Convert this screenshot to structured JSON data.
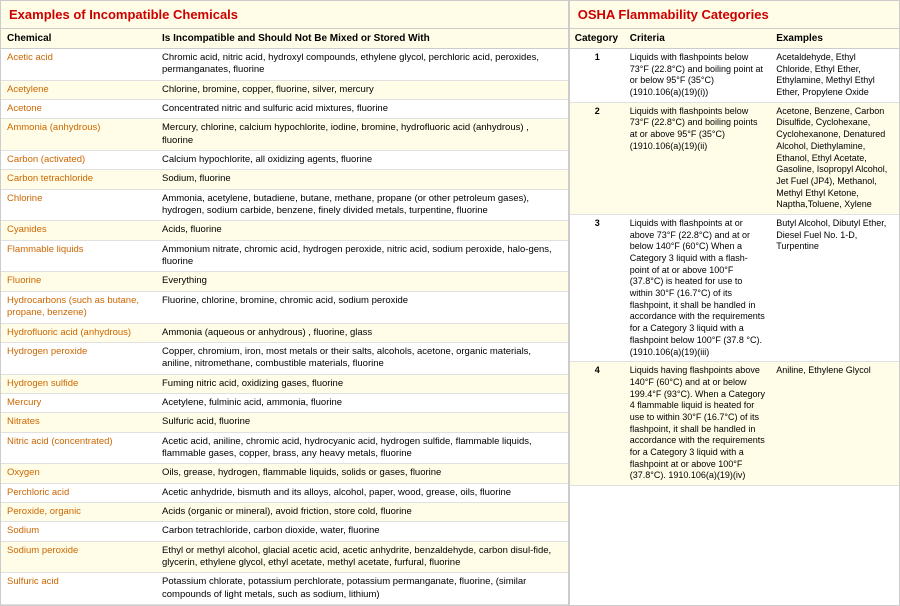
{
  "left": {
    "title": "Examples of Incompatible Chemicals",
    "col1": "Chemical",
    "col2": "Is Incompatible and Should Not Be Mixed or Stored With",
    "rows": [
      {
        "chemical": "Acetic acid",
        "incompatible": "Chromic acid, nitric acid, hydroxyl compounds, ethylene glycol, perchloric acid, peroxides, permanganates, fluorine"
      },
      {
        "chemical": "Acetylene",
        "incompatible": "Chlorine, bromine, copper, fluorine, silver, mercury"
      },
      {
        "chemical": "Acetone",
        "incompatible": "Concentrated nitric and sulfuric acid mixtures, fluorine"
      },
      {
        "chemical": "Ammonia (anhydrous)",
        "incompatible": "Mercury, chlorine, calcium hypochlorite, iodine, bromine, hydrofluoric acid (anhydrous) , fluorine"
      },
      {
        "chemical": "Carbon (activated)",
        "incompatible": "Calcium hypochlorite, all oxidizing agents, fluorine"
      },
      {
        "chemical": "Carbon tetrachloride",
        "incompatible": "Sodium, fluorine"
      },
      {
        "chemical": "Chlorine",
        "incompatible": "Ammonia, acetylene, butadiene, butane, methane, propane (or other petroleum gases), hydrogen, sodium carbide, benzene, finely divided metals, turpentine, fluorine"
      },
      {
        "chemical": "Cyanides",
        "incompatible": "Acids, fluorine"
      },
      {
        "chemical": "Flammable liquids",
        "incompatible": "Ammonium nitrate, chromic acid, hydrogen peroxide, nitric acid, sodium peroxide, halo-gens, fluorine"
      },
      {
        "chemical": "Fluorine",
        "incompatible": "Everything"
      },
      {
        "chemical": "Hydrocarbons (such as butane, propane, benzene)",
        "incompatible": "Fluorine, chlorine, bromine, chromic acid, sodium peroxide"
      },
      {
        "chemical": "Hydrofluoric acid (anhydrous)",
        "incompatible": "Ammonia (aqueous or anhydrous) , fluorine, glass"
      },
      {
        "chemical": "Hydrogen peroxide",
        "incompatible": "Copper, chromium, iron, most metals or their salts, alcohols, acetone, organic materials, aniline, nitromethane, combustible materials, fluorine"
      },
      {
        "chemical": "Hydrogen sulfide",
        "incompatible": "Fuming nitric acid, oxidizing gases, fluorine"
      },
      {
        "chemical": "Mercury",
        "incompatible": "Acetylene, fulminic acid, ammonia, fluorine"
      },
      {
        "chemical": "Nitrates",
        "incompatible": "Sulfuric acid, fluorine"
      },
      {
        "chemical": "Nitric acid (concentrated)",
        "incompatible": "Acetic acid, aniline, chromic acid, hydrocyanic acid, hydrogen sulfide, flammable liquids, flammable gases, copper, brass, any heavy metals, fluorine"
      },
      {
        "chemical": "Oxygen",
        "incompatible": "Oils, grease, hydrogen, flammable liquids, solids or gases, fluorine"
      },
      {
        "chemical": "Perchloric acid",
        "incompatible": "Acetic anhydride, bismuth and its alloys, alcohol, paper, wood, grease, oils, fluorine"
      },
      {
        "chemical": "Peroxide, organic",
        "incompatible": "Acids (organic or mineral), avoid friction, store cold, fluorine"
      },
      {
        "chemical": "Sodium",
        "incompatible": "Carbon tetrachloride, carbon dioxide, water, fluorine"
      },
      {
        "chemical": "Sodium peroxide",
        "incompatible": "Ethyl or methyl alcohol, glacial acetic acid, acetic anhydrite, benzaldehyde, carbon disul-fide, glycerin, ethylene glycol, ethyl acetate, methyl acetate, furfural, fluorine"
      },
      {
        "chemical": "Sulfuric acid",
        "incompatible": "Potassium chlorate, potassium perchlorate, potassium permanganate, fluorine, (similar compounds of light metals, such as sodium, lithium)"
      }
    ]
  },
  "right": {
    "title": "OSHA Flammability Categories",
    "col1": "Category",
    "col2": "Criteria",
    "col3": "Examples",
    "rows": [
      {
        "category": "1",
        "criteria": "Liquids with flashpoints below 73°F (22.8°C) and boiling point at or below 95°F (35°C) (1910.106(a)(19)(i))",
        "examples": "Acetaldehyde, Ethyl Chloride, Ethyl Ether, Ethylamine, Methyl Ethyl Ether, Propylene Oxide"
      },
      {
        "category": "2",
        "criteria": "Liquids with flashpoints below 73°F (22.8°C) and boiling points at or above 95°F (35°C) (1910.106(a)(19)(ii)",
        "examples": "Acetone, Benzene, Carbon Disulfide, Cyclohexane, Cyclohexanone, Denatured Alcohol, Diethylamine, Ethanol, Ethyl Acetate, Gasoline, Isopropyl Alcohol, Jet Fuel (JP4), Methanol, Methyl Ethyl Ketone, Naptha,Toluene, Xylene"
      },
      {
        "category": "3",
        "criteria": "Liquids with flashpoints at or above 73°F (22.8°C) and at or below 140°F (60°C) When a Category 3 liquid with a flash-point of at or above 100°F (37.8°C) is heated for use to within 30°F (16.7°C) of its flashpoint, it shall be handled in accordance with the requirements for a Category 3 liquid with a flashpoint below 100°F (37.8 °C). (1910.106(a)(19)(iii)",
        "examples": "Butyl Alcohol, Dibutyl Ether, Diesel Fuel No. 1-D, Turpentine"
      },
      {
        "category": "4",
        "criteria": "Liquids having flashpoints above 140°F (60°C) and at or below 199.4°F (93°C). When a Category 4 flammable liquid is heated for use to within 30°F (16.7°C) of its flashpoint, it shall be handled in accordance with the requirements for a Category 3 liquid with a flashpoint at or above 100°F (37.8°C). 1910.106(a)(19)(iv)",
        "examples": "Aniline, Ethylene Glycol"
      }
    ]
  }
}
